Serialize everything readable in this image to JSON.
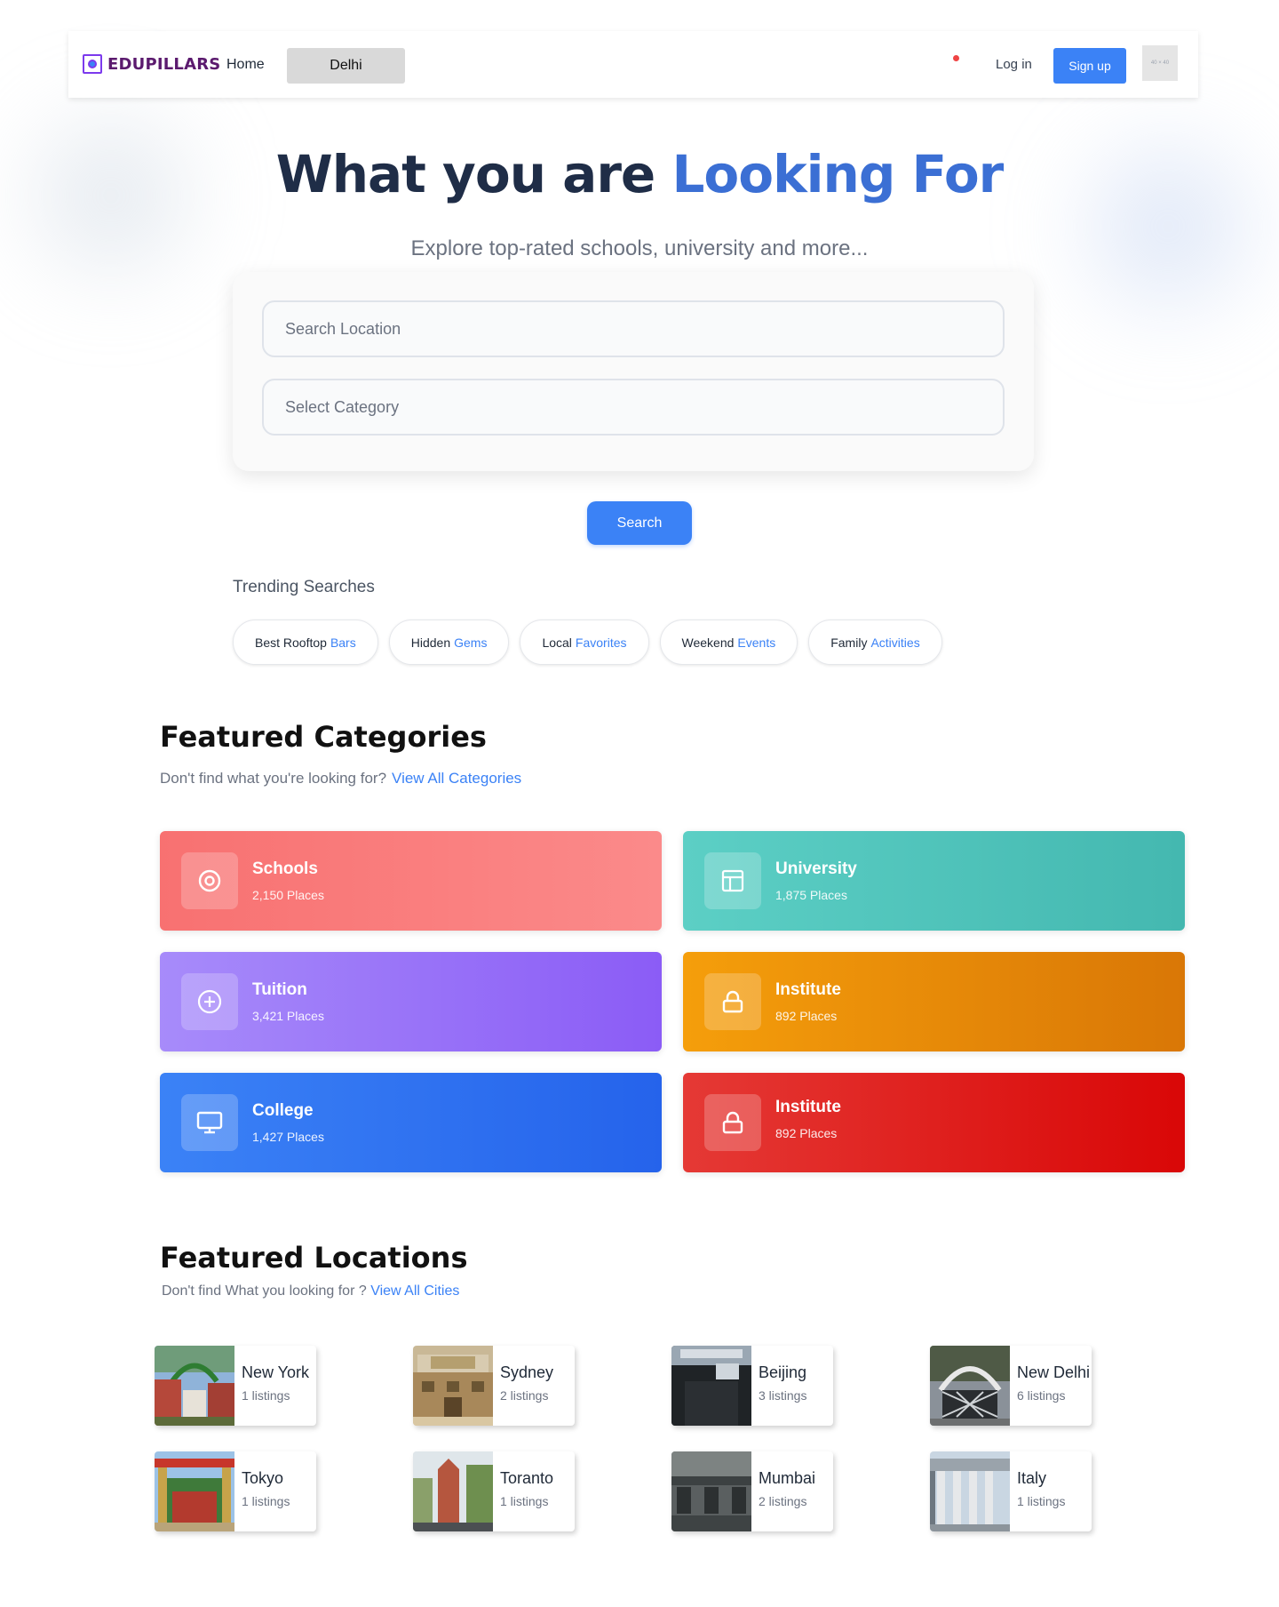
{
  "nav": {
    "logo_text": "EDUPILLARS",
    "home_label": "Home",
    "city_label": "Delhi",
    "login_label": "Log in",
    "signup_label": "Sign up",
    "avatar_text": "40 × 40"
  },
  "hero": {
    "title_part1": "What you are ",
    "title_part2": "Looking For",
    "subtitle": "Explore top-rated schools, university and more...",
    "location_placeholder": "Search Location",
    "category_placeholder": "Select Category",
    "search_label": "Search"
  },
  "trending": {
    "title": "Trending Searches",
    "items": [
      {
        "word1": "Best Rooftop",
        "word2": "Bars"
      },
      {
        "word1": "Hidden",
        "word2": "Gems"
      },
      {
        "word1": "Local",
        "word2": "Favorites"
      },
      {
        "word1": "Weekend",
        "word2": "Events"
      },
      {
        "word1": "Family",
        "word2": "Activities"
      }
    ]
  },
  "featured_categories": {
    "title": "Featured Categories",
    "subtitle": "Don't find what you're looking for?",
    "link": "View All Categories",
    "items": [
      {
        "name": "Schools",
        "count": "2,150 Places",
        "icon": "target-icon",
        "color_from": "#f87171",
        "color_to": "#fb8a8a"
      },
      {
        "name": "University",
        "count": "1,875 Places",
        "icon": "layout-icon",
        "color_from": "#5ccfc5",
        "color_to": "#44b8b0"
      },
      {
        "name": "Tuition",
        "count": "3,421 Places",
        "icon": "plus-circle-icon",
        "color_from": "#a78bfa",
        "color_to": "#8b5cf6"
      },
      {
        "name": "Institute",
        "count": "892 Places",
        "icon": "lock-icon",
        "color_from": "#f59e0b",
        "color_to": "#d97706"
      },
      {
        "name": "College",
        "count": "1,427 Places",
        "icon": "monitor-icon",
        "color_from": "#3b82f6",
        "color_to": "#2563eb"
      },
      {
        "name": "Institute",
        "count": "892 Places",
        "icon": "lock-icon",
        "color_from": "#e53935",
        "color_to": "#d90707"
      }
    ]
  },
  "featured_locations": {
    "title": "Featured Locations",
    "subtitle": "Don't find What you looking for ?",
    "link": "View All Cities",
    "items": [
      {
        "name": "New York",
        "count": "1 listings"
      },
      {
        "name": "Sydney",
        "count": "2 listings"
      },
      {
        "name": "Beijing",
        "count": "3 listings"
      },
      {
        "name": "New Delhi",
        "count": "6 listings"
      },
      {
        "name": "Tokyo",
        "count": "1 listings"
      },
      {
        "name": "Toranto",
        "count": "1 listings"
      },
      {
        "name": "Mumbai",
        "count": "2 listings"
      },
      {
        "name": "Italy",
        "count": "1 listings"
      }
    ]
  }
}
